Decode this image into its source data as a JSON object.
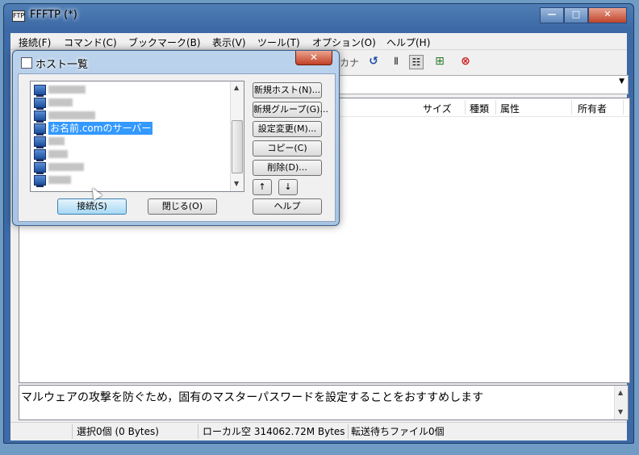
{
  "window": {
    "title": "FFFTP (*)",
    "min": "—",
    "max": "□",
    "close": "✕"
  },
  "menu": [
    "接続(F)",
    "コマンド(C)",
    "ブックマーク(B)",
    "表示(V)",
    "ツール(T)",
    "オプション(O)",
    "ヘルプ(H)"
  ],
  "toolbar": {
    "partial_label": "カナ",
    "icons": [
      "refresh-icon",
      "list-view-icon",
      "detail-view-icon",
      "tree-icon",
      "stop-icon"
    ]
  },
  "filelist": {
    "columns": [
      "サイズ",
      "種類",
      "属性",
      "所有者"
    ]
  },
  "message": "マルウェアの攻撃を防ぐため，固有のマスターパスワードを設定することをおすすめします",
  "status": [
    "",
    "選択0個 (0 Bytes)",
    "ローカル空 314062.72M Bytes",
    "転送待ちファイル0個"
  ],
  "dialog": {
    "title": "ホスト一覧",
    "close": "✕",
    "hosts": [
      {
        "label": "",
        "blur_w": 46,
        "selected": false
      },
      {
        "label": "",
        "blur_w": 30,
        "selected": false
      },
      {
        "label": "",
        "blur_w": 58,
        "selected": false
      },
      {
        "label": "お名前.comのサーバー",
        "blur_w": 0,
        "selected": true
      },
      {
        "label": "",
        "blur_w": 20,
        "selected": false
      },
      {
        "label": "",
        "blur_w": 24,
        "selected": false
      },
      {
        "label": "",
        "blur_w": 44,
        "selected": false
      },
      {
        "label": "",
        "blur_w": 28,
        "selected": false
      }
    ],
    "buttons": {
      "new_host": "新規ホスト(N)...",
      "new_group": "新規グループ(G)...",
      "edit": "設定変更(M)...",
      "copy": "コピー(C)",
      "delete": "削除(D)...",
      "up": "↑",
      "down": "↓",
      "help": "ヘルプ",
      "connect": "接続(S)",
      "close_btn": "閉じる(O)"
    }
  }
}
